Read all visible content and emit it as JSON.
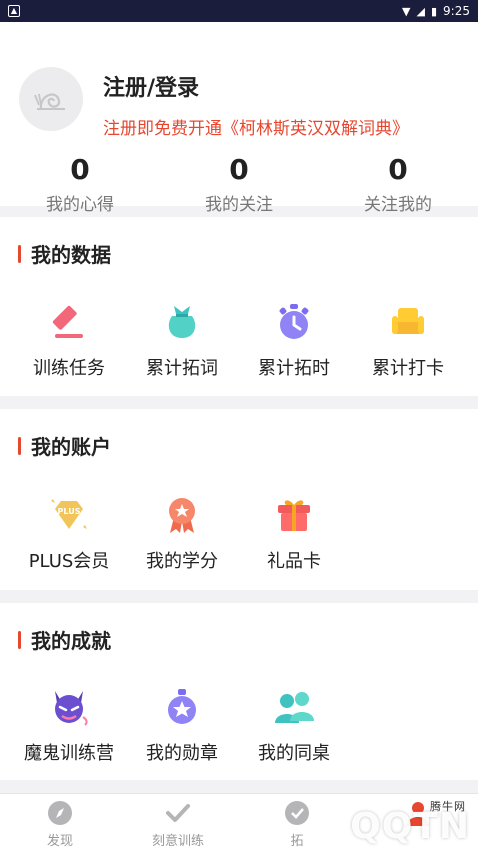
{
  "status_bar": {
    "time": "9:25"
  },
  "profile": {
    "login_title": "注册/登录",
    "promo": "注册即免费开通《柯林斯英汉双解词典》",
    "stats": [
      {
        "value": "0",
        "label": "我的心得"
      },
      {
        "value": "0",
        "label": "我的关注"
      },
      {
        "value": "0",
        "label": "关注我的"
      }
    ]
  },
  "sections": {
    "data": {
      "title": "我的数据",
      "items": [
        {
          "label": "训练任务",
          "icon": "pencil-icon"
        },
        {
          "label": "累计拓词",
          "icon": "bag-icon"
        },
        {
          "label": "累计拓时",
          "icon": "stopwatch-icon"
        },
        {
          "label": "累计打卡",
          "icon": "sofa-icon"
        }
      ]
    },
    "account": {
      "title": "我的账户",
      "items": [
        {
          "label": "PLUS会员",
          "icon": "plus-diamond-icon",
          "badge": "PLUS"
        },
        {
          "label": "我的学分",
          "icon": "ribbon-badge-icon"
        },
        {
          "label": "礼品卡",
          "icon": "gift-icon"
        }
      ]
    },
    "achievement": {
      "title": "我的成就",
      "items": [
        {
          "label": "魔鬼训练营",
          "icon": "devil-icon"
        },
        {
          "label": "我的勋章",
          "icon": "medal-icon"
        },
        {
          "label": "我的同桌",
          "icon": "users-icon"
        }
      ]
    }
  },
  "tabs": [
    {
      "label": "发现",
      "icon": "compass-icon"
    },
    {
      "label": "刻意训练",
      "icon": "check-icon"
    },
    {
      "label": "拓",
      "icon": "expand-icon"
    },
    {
      "label": "",
      "icon": "person-icon"
    }
  ],
  "watermark": {
    "text": "QQTN",
    "sub": "腾牛网"
  },
  "colors": {
    "accent": "#e8472f",
    "statusbar": "#1a1d3b"
  }
}
